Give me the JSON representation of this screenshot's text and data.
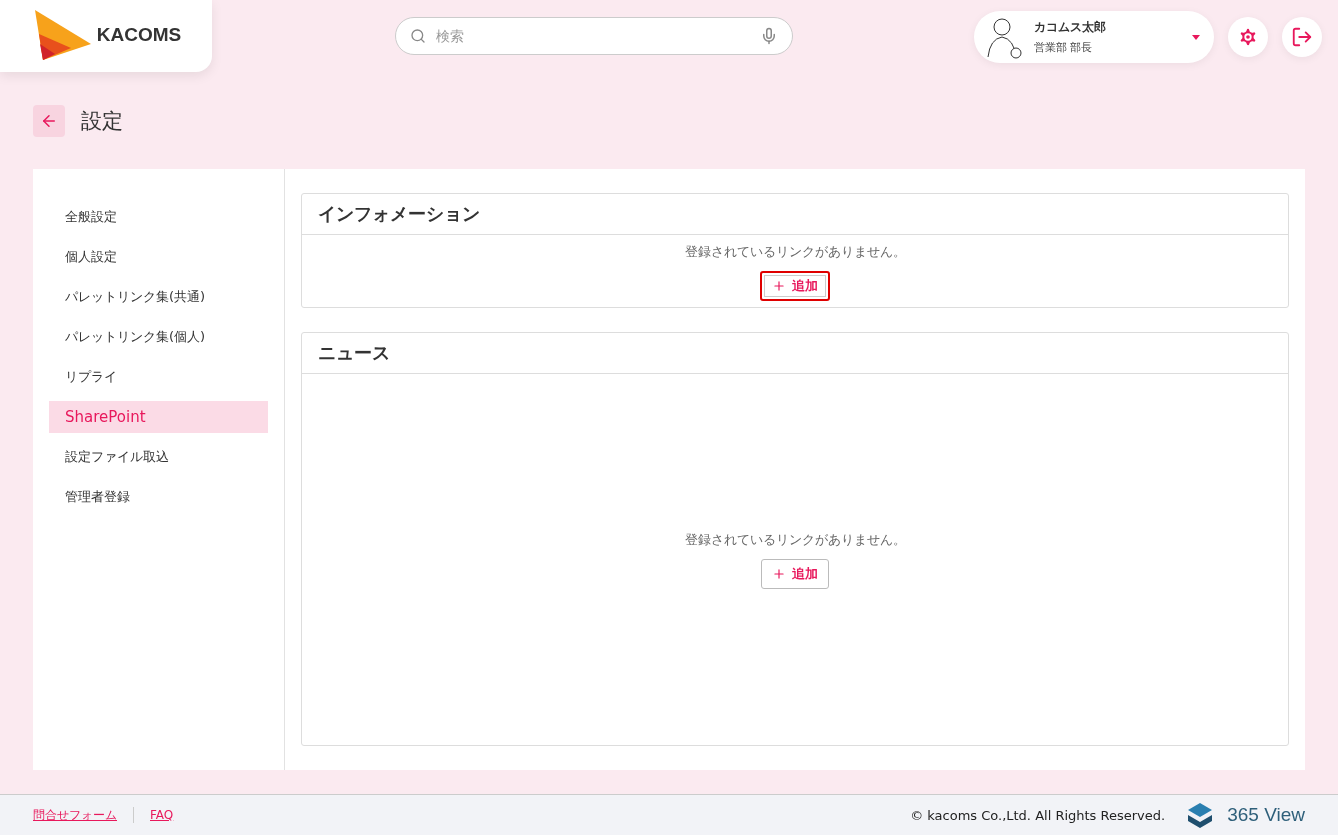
{
  "header": {
    "logo_text": "KACOMS",
    "search": {
      "placeholder": "検索"
    },
    "user": {
      "name": "カコムス太郎",
      "role": "営業部 部長"
    }
  },
  "page": {
    "title": "設定"
  },
  "sidebar": {
    "items": [
      {
        "label": "全般設定",
        "selected": false
      },
      {
        "label": "個人設定",
        "selected": false
      },
      {
        "label": "パレットリンク集(共通)",
        "selected": false
      },
      {
        "label": "パレットリンク集(個人)",
        "selected": false
      },
      {
        "label": "リプライ",
        "selected": false
      },
      {
        "label": "SharePoint",
        "selected": true
      },
      {
        "label": "設定ファイル取込",
        "selected": false
      },
      {
        "label": "管理者登録",
        "selected": false
      }
    ]
  },
  "panels": [
    {
      "title": "インフォメーション",
      "message": "登録されているリンクがありません。",
      "button": {
        "label": "追加",
        "highlighted": true
      },
      "tall": false
    },
    {
      "title": "ニュース",
      "message": "登録されているリンクがありません。",
      "button": {
        "label": "追加",
        "highlighted": false
      },
      "tall": true
    }
  ],
  "footer": {
    "links": [
      "問合せフォーム",
      "FAQ"
    ],
    "copyright": "© kacoms Co.,Ltd. All Rights Reserved.",
    "brand": "365 View"
  }
}
